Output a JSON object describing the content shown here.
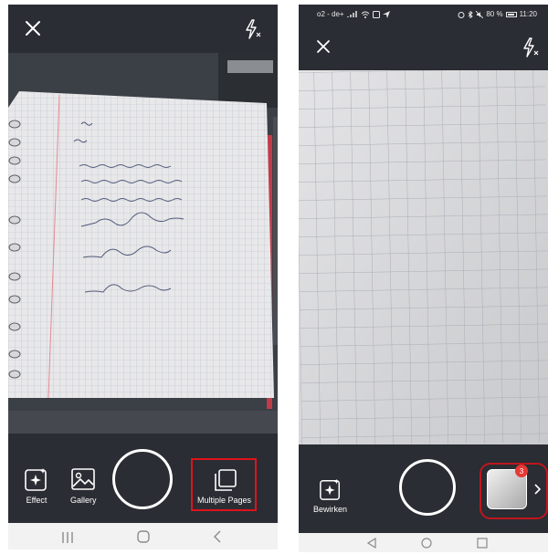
{
  "left_screen": {
    "tools": {
      "effect_label": "Effect",
      "gallery_label": "Gallery",
      "multiple_pages_label": "Multiple Pages"
    }
  },
  "right_screen": {
    "status_bar": {
      "carrier": "o2 - de+",
      "battery_percent": "80 %",
      "time": "11:20"
    },
    "tools": {
      "effect_label": "Bewirken"
    },
    "thumbnail_badge_count": "3"
  },
  "colors": {
    "highlight": "#e0121b",
    "app_bar": "#2a2d33",
    "badge": "#e53935"
  },
  "icons": [
    "close-icon",
    "flash-off-icon",
    "effect-sparkle-icon",
    "gallery-image-icon",
    "multiple-pages-icon",
    "chevron-right-icon",
    "nav-recents-icon",
    "nav-home-icon",
    "nav-back-icon"
  ]
}
